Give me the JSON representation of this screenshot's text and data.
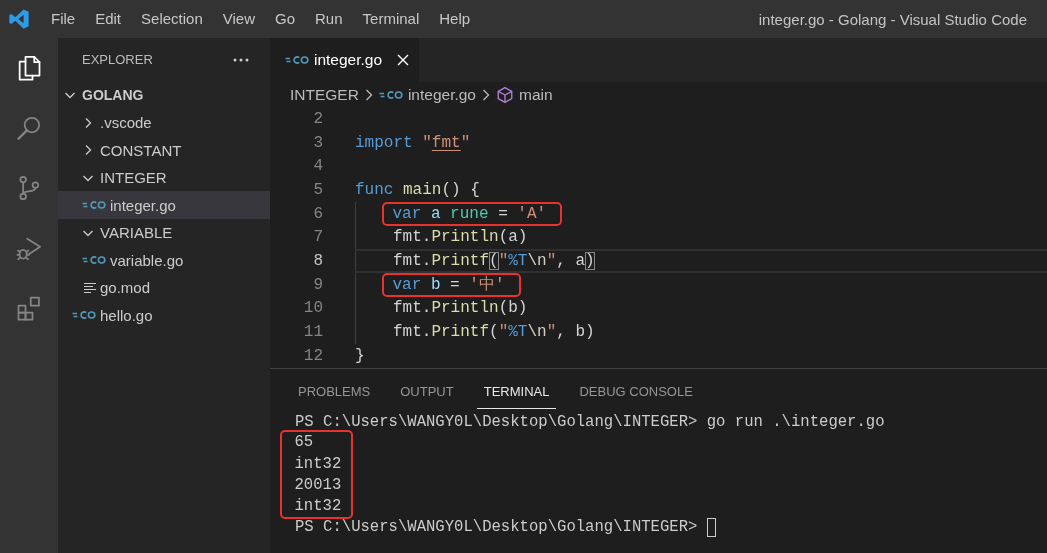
{
  "window": {
    "title": "integer.go - Golang - Visual Studio Code"
  },
  "menu": [
    "File",
    "Edit",
    "Selection",
    "View",
    "Go",
    "Run",
    "Terminal",
    "Help"
  ],
  "activity_bar": {
    "items": [
      {
        "kind": "explorer",
        "selected": true
      },
      {
        "kind": "search",
        "selected": false
      },
      {
        "kind": "source-control",
        "selected": false
      },
      {
        "kind": "run-debug",
        "selected": false
      },
      {
        "kind": "extensions",
        "selected": false
      }
    ]
  },
  "sidebar": {
    "title": "EXPLORER",
    "workspace": {
      "name": "GOLANG",
      "expanded": true,
      "items": [
        {
          "kind": "folder",
          "name": ".vscode",
          "expanded": false,
          "selected": false
        },
        {
          "kind": "folder",
          "name": "CONSTANT",
          "expanded": false,
          "selected": false
        },
        {
          "kind": "folder",
          "name": "INTEGER",
          "expanded": true,
          "selected": false,
          "children": [
            {
              "kind": "go",
              "name": "integer.go",
              "selected": true
            }
          ]
        },
        {
          "kind": "folder",
          "name": "VARIABLE",
          "expanded": true,
          "selected": false,
          "children": [
            {
              "kind": "go",
              "name": "variable.go",
              "selected": false
            }
          ]
        },
        {
          "kind": "mod",
          "name": "go.mod",
          "selected": false
        },
        {
          "kind": "go",
          "name": "hello.go",
          "selected": false
        }
      ]
    }
  },
  "editor": {
    "tabs": [
      {
        "kind": "go",
        "name": "integer.go",
        "selected": true
      }
    ],
    "breadcrumbs": [
      {
        "kind": "folder",
        "text": "INTEGER"
      },
      {
        "kind": "go",
        "text": "integer.go"
      },
      {
        "kind": "symbol",
        "text": "main"
      }
    ],
    "lines": [
      {
        "number": "2",
        "indented": false,
        "current": false,
        "boxed": false
      },
      {
        "number": "3",
        "indented": false,
        "current": false,
        "boxed": false,
        "tokens": [
          {
            "kind": "keyword",
            "text": "import "
          },
          {
            "kind": "string",
            "text": "\""
          },
          {
            "kind": "link",
            "text": "fmt"
          },
          {
            "kind": "string",
            "text": "\""
          }
        ]
      },
      {
        "number": "4",
        "indented": false,
        "current": false,
        "boxed": false
      },
      {
        "number": "5",
        "indented": false,
        "current": false,
        "boxed": false,
        "tokens": [
          {
            "kind": "keyword",
            "text": "func "
          },
          {
            "kind": "function",
            "text": "main"
          },
          {
            "kind": "plain",
            "text": "() {"
          }
        ]
      },
      {
        "number": "6",
        "indented": true,
        "current": false,
        "boxed": true,
        "tokens": [
          {
            "kind": "keyword",
            "text": "var "
          },
          {
            "kind": "variable",
            "text": "a "
          },
          {
            "kind": "type",
            "text": "rune "
          },
          {
            "kind": "plain",
            "text": "= "
          },
          {
            "kind": "string",
            "text": "'A'"
          }
        ]
      },
      {
        "number": "7",
        "indented": true,
        "current": false,
        "boxed": false,
        "tokens": [
          {
            "kind": "plain",
            "text": "fmt."
          },
          {
            "kind": "function",
            "text": "Println"
          },
          {
            "kind": "plain",
            "text": "(a)"
          }
        ]
      },
      {
        "number": "8",
        "indented": true,
        "current": true,
        "boxed": false,
        "tokens": [
          {
            "kind": "plain",
            "text": "fmt."
          },
          {
            "kind": "function",
            "text": "Printf"
          },
          {
            "kind": "bracket",
            "text": "("
          },
          {
            "kind": "string",
            "text": "\""
          },
          {
            "kind": "format",
            "text": "%T"
          },
          {
            "kind": "escape",
            "text": "\\n"
          },
          {
            "kind": "string",
            "text": "\""
          },
          {
            "kind": "plain",
            "text": ", a"
          },
          {
            "kind": "bracket",
            "text": ")"
          }
        ]
      },
      {
        "number": "9",
        "indented": true,
        "current": false,
        "boxed": true,
        "tokens": [
          {
            "kind": "keyword",
            "text": "var "
          },
          {
            "kind": "variable",
            "text": "b "
          },
          {
            "kind": "plain",
            "text": "= "
          },
          {
            "kind": "string",
            "text": "'中'"
          }
        ]
      },
      {
        "number": "10",
        "indented": true,
        "current": false,
        "boxed": false,
        "tokens": [
          {
            "kind": "plain",
            "text": "fmt."
          },
          {
            "kind": "function",
            "text": "Println"
          },
          {
            "kind": "plain",
            "text": "(b)"
          }
        ]
      },
      {
        "number": "11",
        "indented": true,
        "current": false,
        "boxed": false,
        "tokens": [
          {
            "kind": "plain",
            "text": "fmt."
          },
          {
            "kind": "function",
            "text": "Printf"
          },
          {
            "kind": "plain",
            "text": "("
          },
          {
            "kind": "string",
            "text": "\""
          },
          {
            "kind": "format",
            "text": "%T"
          },
          {
            "kind": "escape",
            "text": "\\n"
          },
          {
            "kind": "string",
            "text": "\""
          },
          {
            "kind": "plain",
            "text": ", b)"
          }
        ]
      },
      {
        "number": "12",
        "indented": false,
        "current": false,
        "boxed": false,
        "tokens": [
          {
            "kind": "plain",
            "text": "}"
          }
        ]
      }
    ]
  },
  "panel": {
    "tabs": [
      {
        "label": "PROBLEMS",
        "selected": false
      },
      {
        "label": "OUTPUT",
        "selected": false
      },
      {
        "label": "TERMINAL",
        "selected": true
      },
      {
        "label": "DEBUG CONSOLE",
        "selected": false
      }
    ],
    "terminal": {
      "lines": [
        {
          "text": "PS C:\\Users\\WANGY0L\\Desktop\\Golang\\INTEGER> go run .\\integer.go",
          "boxed": false
        },
        {
          "text": "65",
          "boxed": true
        },
        {
          "text": "int32",
          "boxed": true
        },
        {
          "text": "20013",
          "boxed": true
        },
        {
          "text": "int32",
          "boxed": true
        },
        {
          "text": "PS C:\\Users\\WANGY0L\\Desktop\\Golang\\INTEGER>",
          "boxed": false
        }
      ],
      "cursor": true
    }
  }
}
